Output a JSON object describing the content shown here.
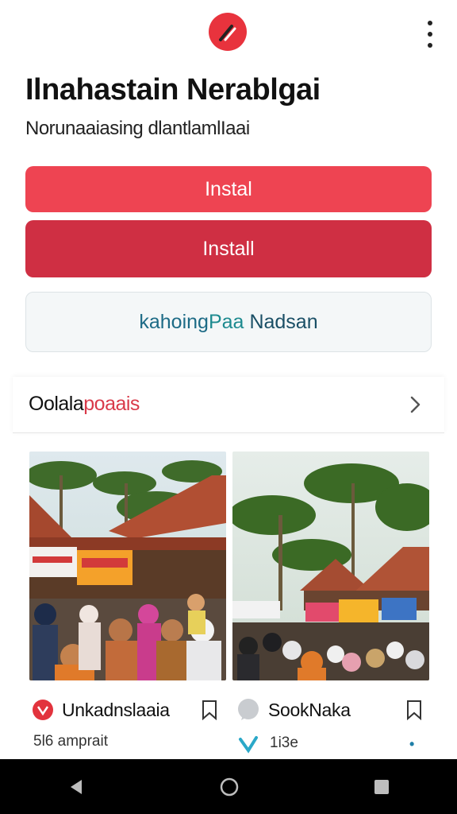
{
  "header": {
    "logo_icon": "app-logo-icon",
    "menu_icon": "more-vert-icon"
  },
  "app": {
    "title": "Ilnahastain Nerablgai",
    "subtitle": "Norunaaiasing dlantlamlIaai"
  },
  "buttons": {
    "install_primary": "Instal",
    "install_secondary": "Install",
    "outline_prefix": "kahoing",
    "outline_mid": "Paa",
    "outline_suffix": "Nadsan"
  },
  "section": {
    "title_a": "Oolala",
    "title_b": "poaais",
    "chevron_icon": "chevron-right-icon"
  },
  "cards": [
    {
      "title": "Unkadnslaaia",
      "meta": "5l6 amprait",
      "icon": "red-circle-icon",
      "bookmark_icon": "bookmark-icon"
    },
    {
      "title": "SookNaka",
      "meta": "1i3e",
      "icon": "chat-bubble-icon",
      "bookmark_icon": "bookmark-icon"
    }
  ],
  "colors": {
    "brand_red": "#e8333d",
    "button_primary": "#ee4452",
    "button_secondary": "#cf2f43",
    "accent_text": "#d93a4a",
    "outline_text": "#1d6b86"
  },
  "navbar": {
    "back_icon": "back-triangle-icon",
    "home_icon": "home-circle-icon",
    "recents_icon": "recents-square-icon"
  }
}
